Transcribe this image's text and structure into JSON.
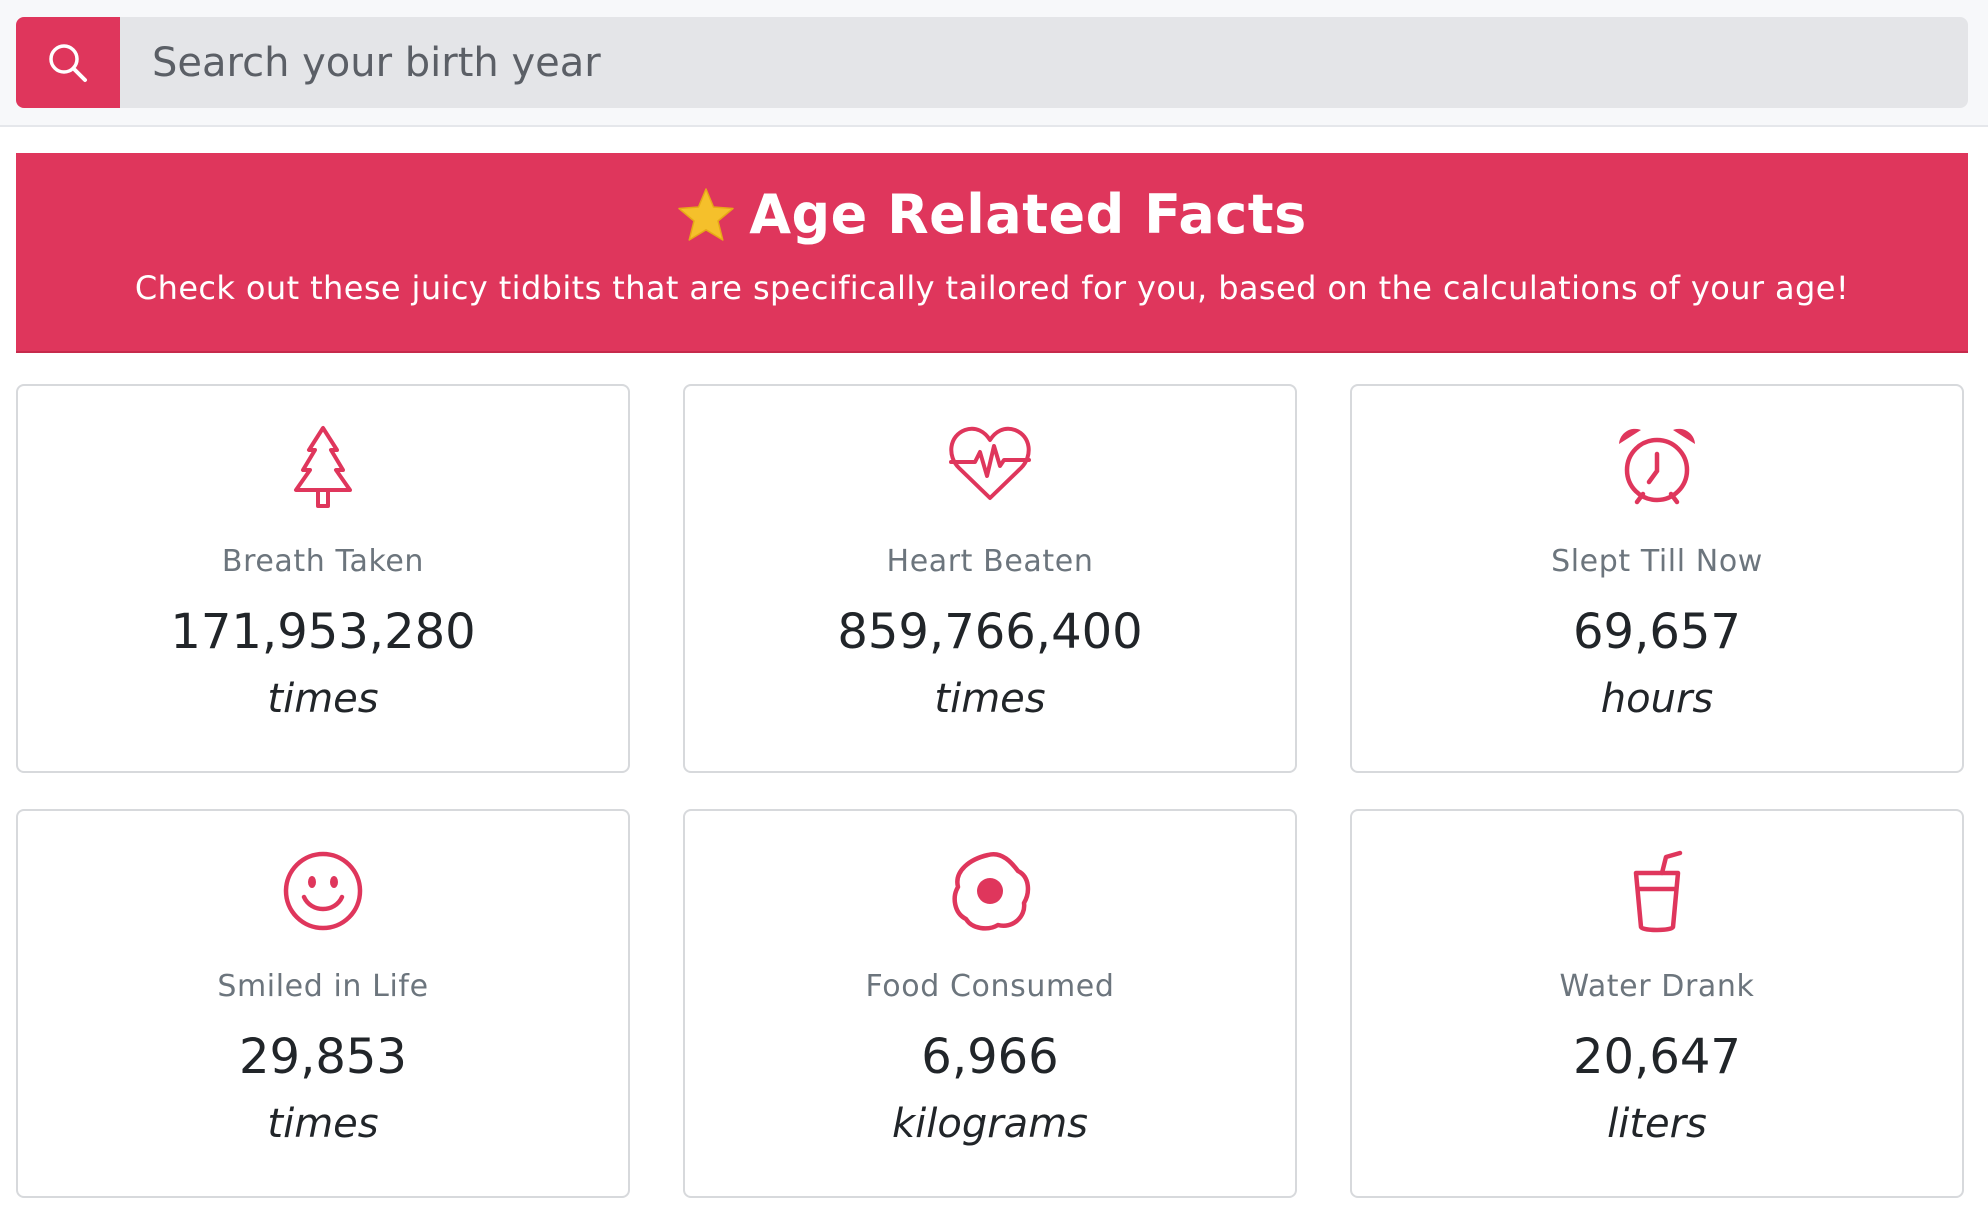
{
  "search": {
    "placeholder": "Search your birth year",
    "value": ""
  },
  "banner": {
    "title": "Age Related Facts",
    "subtitle": "Check out these juicy tidbits that are specifically tailored for you, based on the calculations of your age!"
  },
  "colors": {
    "accent": "#df365c",
    "star": "#f5c02b",
    "muted_text": "#6c757d",
    "card_border": "#d7d9dc"
  },
  "facts": [
    {
      "icon": "tree-icon",
      "label": "Breath Taken",
      "value": "171,953,280",
      "unit": "times"
    },
    {
      "icon": "heartbeat-icon",
      "label": "Heart Beaten",
      "value": "859,766,400",
      "unit": "times"
    },
    {
      "icon": "alarm-clock-icon",
      "label": "Slept Till Now",
      "value": "69,657",
      "unit": "hours"
    },
    {
      "icon": "smiley-icon",
      "label": "Smiled in Life",
      "value": "29,853",
      "unit": "times"
    },
    {
      "icon": "fried-egg-icon",
      "label": "Food Consumed",
      "value": "6,966",
      "unit": "kilograms"
    },
    {
      "icon": "cup-straw-icon",
      "label": "Water Drank",
      "value": "20,647",
      "unit": "liters"
    }
  ]
}
